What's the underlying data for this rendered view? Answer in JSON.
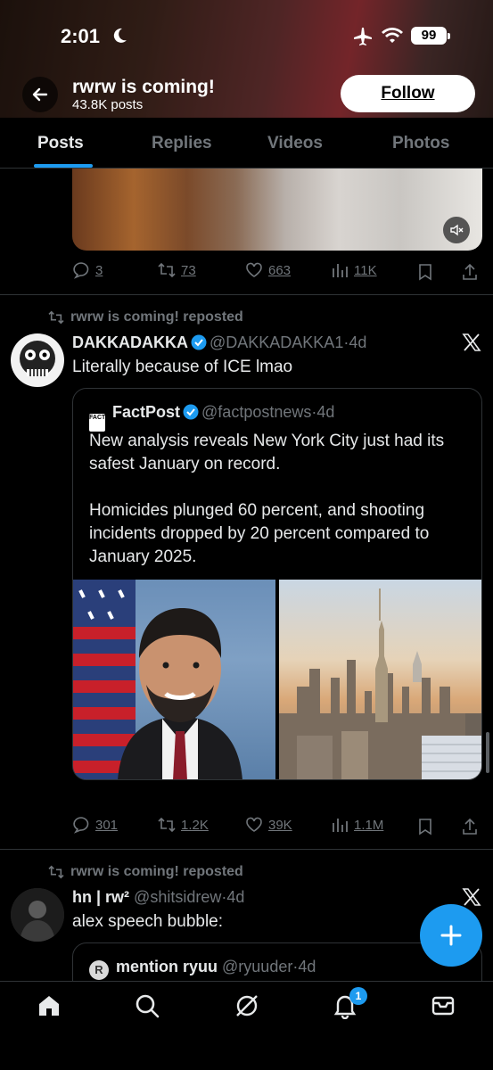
{
  "status_bar": {
    "time": "2:01",
    "battery": "99"
  },
  "header": {
    "title": "rwrw is coming!",
    "subtitle": "43.8K posts",
    "follow_label": "Follow"
  },
  "tabs": [
    {
      "label": "Posts",
      "active": true
    },
    {
      "label": "Replies",
      "active": false
    },
    {
      "label": "Videos",
      "active": false
    },
    {
      "label": "Photos",
      "active": false
    }
  ],
  "post1": {
    "replies": "3",
    "reposts": "73",
    "likes": "663",
    "views": "11K"
  },
  "post2": {
    "repost_label": "rwrw is coming! reposted",
    "display_name": "DAKKADAKKA",
    "handle": "@DAKKADAKKA1",
    "time": "4d",
    "text": "Literally because of ICE lmao",
    "quote": {
      "logo_text": "FACT POST",
      "display_name": "FactPost",
      "handle": "@factpostnews",
      "time": "4d",
      "paragraph1": "New analysis reveals New York City just had its safest January on record.",
      "paragraph2": "Homicides plunged 60 percent, and shooting incidents dropped by 20 percent compared to January 2025."
    },
    "replies": "301",
    "reposts": "1.2K",
    "likes": "39K",
    "views": "1.1M"
  },
  "post3": {
    "repost_label": "rwrw is coming! reposted",
    "display_name": "hn | rw²",
    "handle": "@shitsidrew",
    "time": "4d",
    "text": "alex speech bubble:",
    "quote": {
      "avatar_letter": "R",
      "display_name": "mention ryuu",
      "handle": "@ryuuder",
      "time": "4d"
    }
  },
  "bottom_nav": {
    "notification_count": "1"
  },
  "colors": {
    "accent": "#1d9bf0",
    "background": "#000000",
    "muted": "#71767b"
  }
}
